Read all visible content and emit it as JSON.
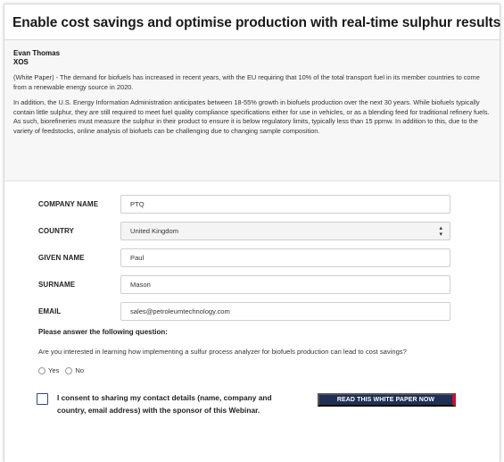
{
  "title": "Enable cost savings and optimise production with real-time sulphur results",
  "article": {
    "author": "Evan Thomas",
    "company": "XOS",
    "paragraph1": "(White Paper) - The demand for biofuels has increased in recent years, with the EU requiring that 10% of the total transport fuel in its member countries to come from a renewable energy source in 2020.",
    "paragraph2": "In addition, the U.S. Energy Information Administration anticipates between 18-55% growth in biofuels production over the next 30 years. While biofuels typically contain little sulphur, they are still required to meet fuel quality compliance specifications either for use in vehicles, or as a blending feed for traditional refinery fuels. As such, biorefineries must measure the sulphur in their product to ensure it is below regulatory limits, typically less than 15 ppmw. In addition to this, due to the variety of feedstocks, online analysis of biofuels can be challenging due to changing sample composition."
  },
  "form": {
    "company": {
      "label": "COMPANY NAME",
      "value": "PTQ"
    },
    "country": {
      "label": "COUNTRY",
      "value": "United Kingdom"
    },
    "given_name": {
      "label": "GIVEN NAME",
      "value": "Paul"
    },
    "surname": {
      "label": "SURNAME",
      "value": "Mason"
    },
    "email": {
      "label": "EMAIL",
      "value": "sales@petroleumtechnology.com"
    },
    "question_heading": "Please answer the following question:",
    "question": "Are you interested in learning how implementing a sulfur process analyzer for biofuels production can lead to cost savings?",
    "options": {
      "yes": "Yes",
      "no": "No"
    },
    "consent": "I consent to sharing my contact details (name, company and country, email address) with the sponsor of this Webinar.",
    "submit": "READ THIS WHITE PAPER NOW"
  },
  "colors": {
    "cta_bg": "#1f2f55",
    "cta_accent": "#c8102e",
    "checkbox_border": "#2b4a8a"
  }
}
